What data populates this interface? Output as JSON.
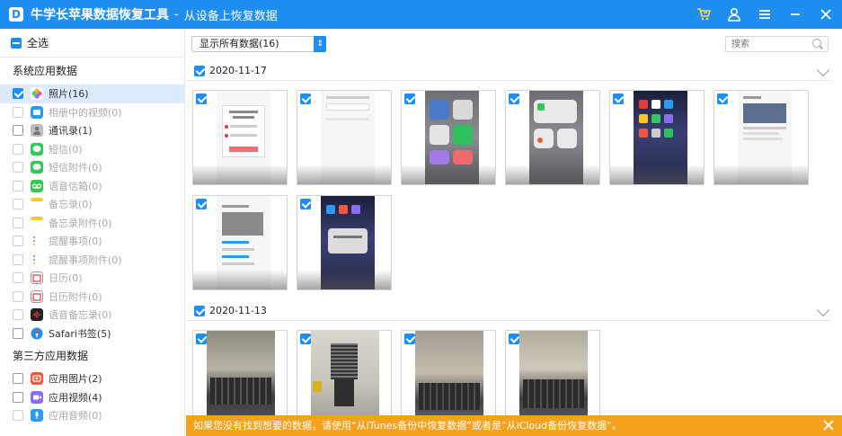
{
  "titlebar": {
    "logo_letter": "D",
    "app_name": "牛学长苹果数据恢复工具",
    "separator": "-",
    "subtitle": "从设备上恢复数据",
    "icons": [
      "cart-icon",
      "user-icon",
      "menu-icon",
      "minimize-icon",
      "close-icon"
    ]
  },
  "sidebar": {
    "select_all": "全选",
    "sections": [
      {
        "title": "系统应用数据",
        "items": [
          {
            "label": "照片(16)",
            "checked": true,
            "icon": "photos-icon",
            "color": "#f2593a"
          },
          {
            "label": "相册中的视频(0)",
            "checked": false,
            "icon": "video-icon",
            "color": "#2a9bf0"
          },
          {
            "label": "通讯录(1)",
            "checked": false,
            "icon": "contacts-icon",
            "color": "#9b9b9b"
          },
          {
            "label": "短信(0)",
            "checked": false,
            "icon": "messages-icon",
            "color": "#35c759"
          },
          {
            "label": "短信附件(0)",
            "checked": false,
            "icon": "messages-attachment-icon",
            "color": "#35c759"
          },
          {
            "label": "语音信箱(0)",
            "checked": false,
            "icon": "voicemail-icon",
            "color": "#35c759"
          },
          {
            "label": "备忘录(0)",
            "checked": false,
            "icon": "notes-icon",
            "color": "#f7c81e"
          },
          {
            "label": "备忘录附件(0)",
            "checked": false,
            "icon": "notes-attachment-icon",
            "color": "#f7c81e"
          },
          {
            "label": "提醒事项(0)",
            "checked": false,
            "icon": "reminders-icon",
            "color": "#ffffff"
          },
          {
            "label": "提醒事项附件(0)",
            "checked": false,
            "icon": "reminders-attachment-icon",
            "color": "#ffffff"
          },
          {
            "label": "日历(0)",
            "checked": false,
            "icon": "calendar-icon",
            "color": "#ffffff"
          },
          {
            "label": "日历附件(0)",
            "checked": false,
            "icon": "calendar-attachment-icon",
            "color": "#ffffff"
          },
          {
            "label": "语音备忘录(0)",
            "checked": false,
            "icon": "voice-memos-icon",
            "color": "#222222"
          },
          {
            "label": "Safari书签(5)",
            "checked": false,
            "icon": "safari-icon",
            "color": "#1e8ff0"
          }
        ]
      },
      {
        "title": "第三方应用数据",
        "items": [
          {
            "label": "应用图片(2)",
            "checked": false,
            "icon": "app-photos-icon",
            "color": "#f2593a"
          },
          {
            "label": "应用视频(4)",
            "checked": false,
            "icon": "app-video-icon",
            "color": "#8e6cf0"
          },
          {
            "label": "应用音频(0)",
            "checked": false,
            "icon": "app-audio-icon",
            "color": "#2a9bf0"
          }
        ]
      }
    ]
  },
  "toolbar": {
    "filter_value": "显示所有数据(16)",
    "search_placeholder": "搜索"
  },
  "groups": [
    {
      "date": "2020-11-17",
      "checked": true,
      "count": 8
    },
    {
      "date": "2020-11-13",
      "checked": true,
      "count": 4
    }
  ],
  "notice": {
    "text": "如果您没有找到想要的数据，请使用“从iTunes备份中恢复数据”或者是“从iCloud备份恢复数据”。"
  },
  "colors": {
    "accent": "#1e8ff0",
    "notice_bg": "#f4a11d",
    "selected_bg": "#dcebfb"
  }
}
